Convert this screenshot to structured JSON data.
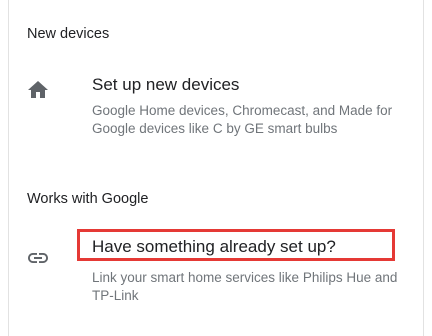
{
  "sections": {
    "new_devices": {
      "header": "New devices",
      "item": {
        "icon": "home-icon",
        "title": "Set up new devices",
        "subtitle": "Google Home devices, Chromecast, and Made for Google devices like C by GE smart bulbs"
      }
    },
    "works_with_google": {
      "header": "Works with Google",
      "item": {
        "icon": "link-icon",
        "title": "Have something already set up?",
        "subtitle": "Link your smart home services like Philips Hue and TP-Link"
      }
    }
  },
  "colors": {
    "highlight": "#e53935",
    "icon": "#5f6368",
    "title": "#202124",
    "subtitle": "#70757a"
  }
}
